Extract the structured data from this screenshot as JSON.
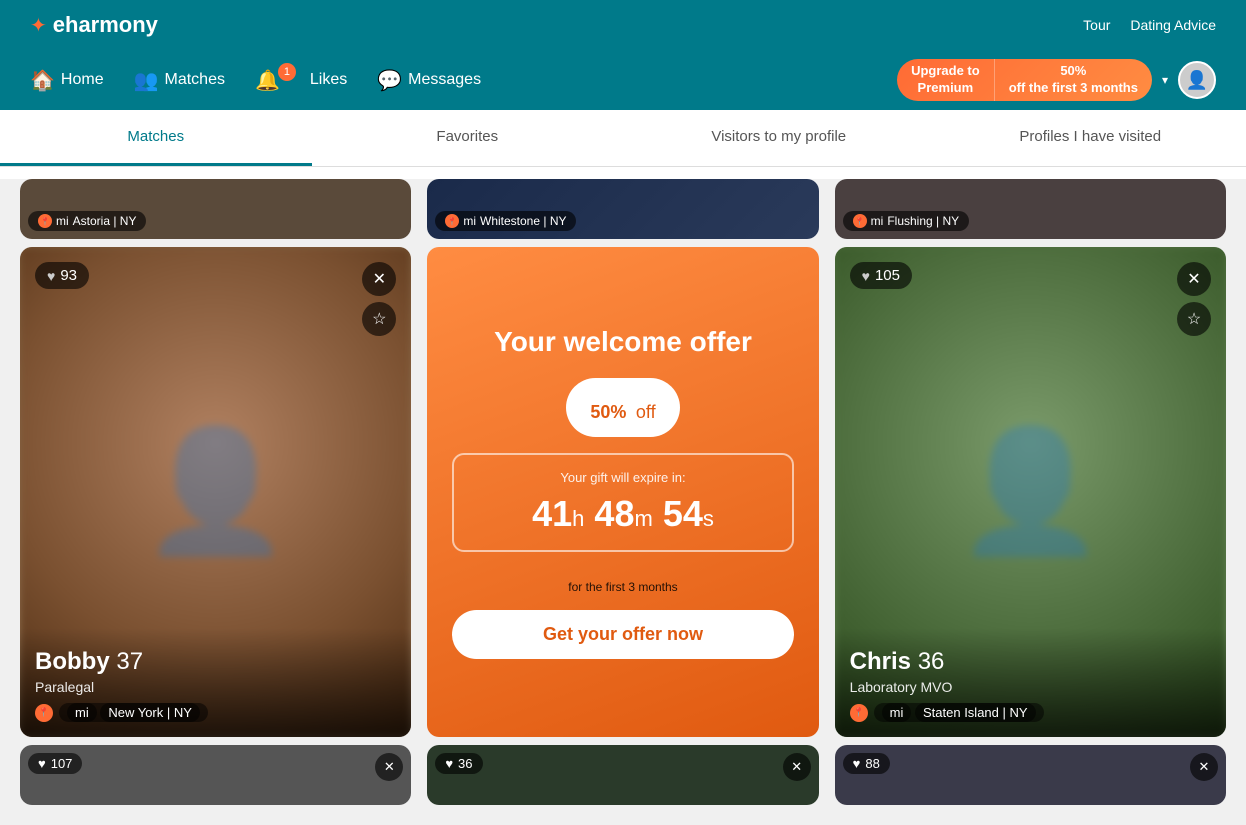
{
  "header": {
    "logo": "eharmony",
    "logo_icon": "✦",
    "top_links": [
      "Tour",
      "Dating Advice"
    ],
    "nav_items": [
      {
        "label": "Home",
        "icon": "🏠",
        "badge": null
      },
      {
        "label": "Matches",
        "icon": "👥",
        "badge": null
      },
      {
        "label": "Likes",
        "icon": "🔔",
        "badge": "1"
      },
      {
        "label": "Messages",
        "icon": "💬",
        "badge": null
      }
    ],
    "upgrade_left": "Upgrade to\nPremium",
    "upgrade_right": "50%\noff the first 3 months",
    "dropdown": "▾"
  },
  "tabs": [
    {
      "label": "Matches",
      "active": true
    },
    {
      "label": "Favorites",
      "active": false
    },
    {
      "label": "Visitors to my profile",
      "active": false
    },
    {
      "label": "Profiles I have visited",
      "active": false
    }
  ],
  "top_cards": [
    {
      "location_mi": "mi",
      "location": "Astoria | NY",
      "bg": "#5a4a3a"
    },
    {
      "location_mi": "mi",
      "location": "Whitestone | NY",
      "bg": "#1a2a4a"
    },
    {
      "location_mi": "mi",
      "location": "Flushing | NY",
      "bg": "#4a4a4a"
    }
  ],
  "main_cards": [
    {
      "type": "profile",
      "heart": "93",
      "name": "Bobby",
      "age": "37",
      "job": "Paralegal",
      "location_mi": "mi",
      "location": "New York | NY",
      "bg": "brown"
    },
    {
      "type": "offer",
      "title": "Your welcome offer",
      "percent": "50%",
      "percent_suffix": "off",
      "expire_label": "Your gift will expire in:",
      "hours": "41",
      "minutes": "48",
      "seconds": "54",
      "h_label": "h",
      "m_label": "m",
      "s_label": "s",
      "months_note": "for the first 3 months",
      "cta": "Get your offer now"
    },
    {
      "type": "profile",
      "heart": "105",
      "name": "Chris",
      "age": "36",
      "job": "Laboratory MVO",
      "location_mi": "mi",
      "location": "Staten Island | NY",
      "bg": "green"
    }
  ],
  "bottom_cards": [
    {
      "heart": "107",
      "bg": "#333"
    },
    {
      "heart": "36",
      "bg": "#2a3a2a"
    },
    {
      "heart": "88",
      "bg": "#3a3a4a"
    }
  ],
  "colors": {
    "teal": "#007a8a",
    "orange": "#ff6b35",
    "offer_bg_start": "#ff8c42",
    "offer_bg_end": "#e05a10"
  }
}
